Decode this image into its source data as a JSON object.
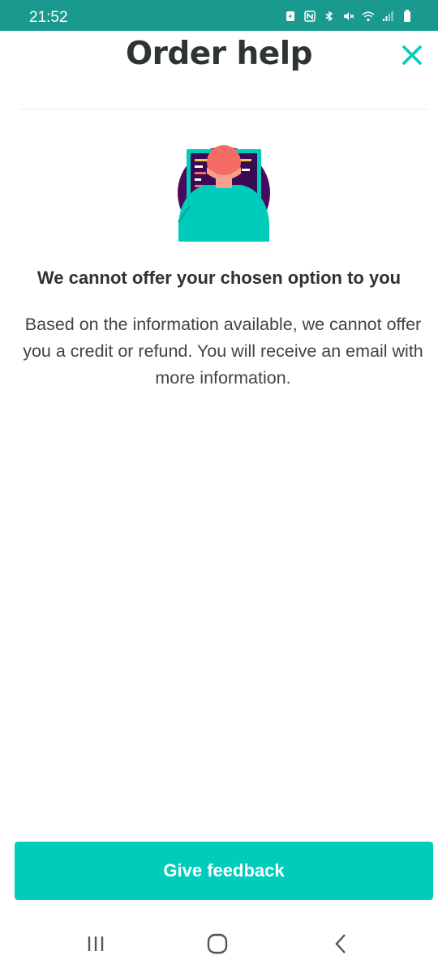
{
  "status_bar": {
    "time": "21:52",
    "icons": [
      "battery-saver-icon",
      "nfc-icon",
      "bluetooth-icon",
      "mute-icon",
      "wifi-icon",
      "signal-icon",
      "battery-icon"
    ]
  },
  "header": {
    "title": "Order help",
    "close_icon": "close-icon"
  },
  "illustration": {
    "name": "person-at-computer-illustration",
    "colors": {
      "circle": "#4a0b5c",
      "screen": "#3b0a55",
      "frame": "#00ccbc",
      "head": "#f46c63",
      "body": "#00ccbc"
    }
  },
  "message": {
    "title": "We cannot offer your chosen option to you",
    "body": "Based on the information available, we cannot offer you a credit or refund. You will receive an email with more information."
  },
  "feedback_button": {
    "label": "Give feedback"
  },
  "navbar": {
    "items": [
      "recent-apps-icon",
      "home-icon",
      "back-icon"
    ]
  },
  "colors": {
    "accent": "#00ccbc",
    "status_bar": "#1a9a8e",
    "text": "#2e3333"
  }
}
